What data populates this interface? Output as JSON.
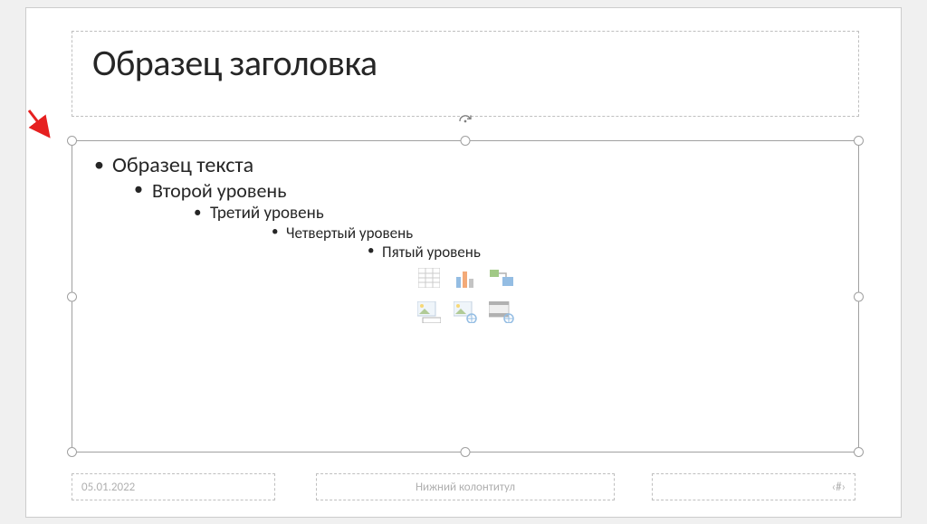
{
  "title": {
    "text": "Образец заголовка"
  },
  "content": {
    "level1": "Образец текста",
    "level2": "Второй уровень",
    "level3": "Третий уровень",
    "level4": "Четвертый уровень",
    "level5": "Пятый уровень",
    "inserters": {
      "table": "insert-table",
      "chart": "insert-chart",
      "smartart": "insert-smartart",
      "picture": "insert-picture",
      "online_picture": "insert-online-picture",
      "video": "insert-video"
    }
  },
  "footer": {
    "date": "05.01.2022",
    "center": "Нижний колонтитул",
    "slide_number": "‹#›"
  },
  "colors": {
    "arrow": "#e62020",
    "handle_border": "#a0a0a0",
    "placeholder_border": "#bfbfbf"
  }
}
